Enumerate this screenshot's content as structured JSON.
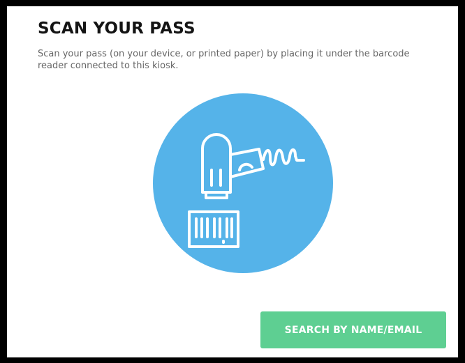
{
  "header": {
    "title": "SCAN YOUR PASS",
    "instructions": "Scan your pass (on your device, or printed paper) by placing it under the barcode reader connected to this kiosk."
  },
  "illustration": {
    "icon": "barcode-scanner-icon",
    "circle_color": "#55b3e9",
    "line_color": "#ffffff"
  },
  "actions": {
    "search_label": "SEARCH BY NAME/EMAIL",
    "button_color": "#5ecf92"
  }
}
